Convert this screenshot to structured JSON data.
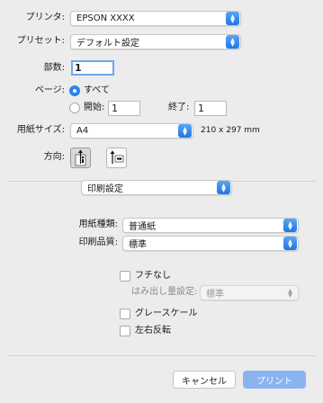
{
  "printer": {
    "label": "プリンタ:",
    "value": "EPSON XXXX"
  },
  "preset": {
    "label": "プリセット:",
    "value": "デフォルト設定"
  },
  "copies": {
    "label": "部数:",
    "value": "1"
  },
  "pages": {
    "label": "ページ:",
    "all_label": "すべて",
    "start_label": "開始:",
    "start_value": "1",
    "end_label": "終了:",
    "end_value": "1"
  },
  "paper_size": {
    "label": "用紙サイズ:",
    "value": "A4",
    "dimensions": "210 x 297 mm"
  },
  "orientation": {
    "label": "方向:"
  },
  "section": {
    "value": "印刷設定"
  },
  "media_type": {
    "label": "用紙種類:",
    "value": "普通紙"
  },
  "quality": {
    "label": "印刷品質:",
    "value": "標準"
  },
  "borderless": {
    "label": "フチなし"
  },
  "expansion": {
    "label": "はみ出し量設定:",
    "value": "標準"
  },
  "grayscale": {
    "label": "グレースケール"
  },
  "mirror": {
    "label": "左右反転"
  },
  "buttons": {
    "cancel": "キャンセル",
    "print": "プリント"
  },
  "colors": {
    "accent": "#2a82ef",
    "print_button": "#8ab4f0",
    "background": "#ececec"
  }
}
